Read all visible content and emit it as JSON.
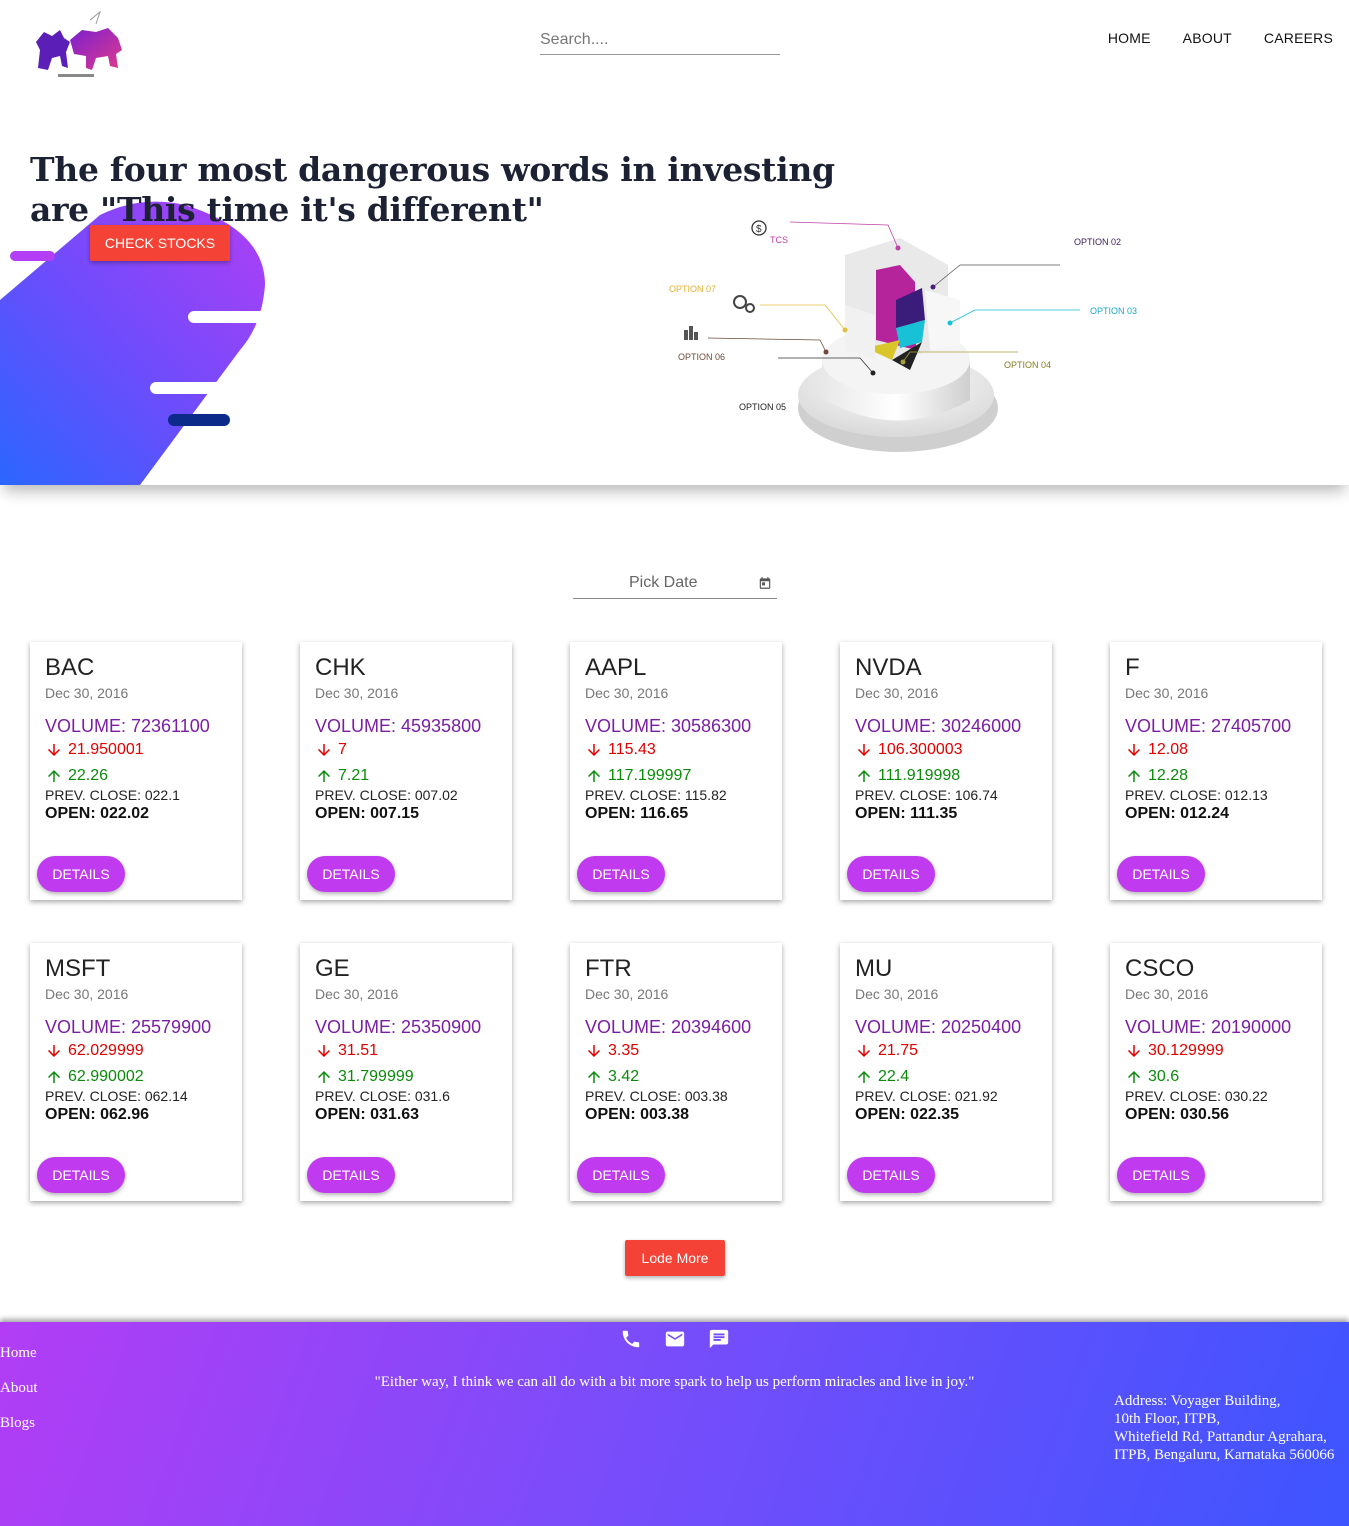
{
  "header": {
    "search_placeholder": "Search....",
    "nav": [
      "HOME",
      "ABOUT",
      "CAREERS"
    ]
  },
  "hero": {
    "quote": "The four most dangerous words in investing are \"This time it's different\"",
    "cta": "CHECK STOCKS",
    "infographic_labels": {
      "tcs": "TCS",
      "option02": "OPTION 02",
      "option03": "OPTION 03",
      "option04": "OPTION 04",
      "option05": "OPTION 05",
      "option06": "OPTION 06",
      "option07": "OPTION 07"
    },
    "accent_colors": [
      "#b33ff5",
      "#2f67ff",
      "#0b2a8a"
    ]
  },
  "date_picker": {
    "label": "Pick Date"
  },
  "stocks": [
    {
      "symbol": "BAC",
      "date": "Dec 30, 2016",
      "volume": "VOLUME: 72361100",
      "low": "21.950001",
      "high": "22.26",
      "prev_close": "PREV. CLOSE: 022.1",
      "open": "OPEN: 022.02",
      "button": "DETAILS"
    },
    {
      "symbol": "CHK",
      "date": "Dec 30, 2016",
      "volume": "VOLUME: 45935800",
      "low": "7",
      "high": "7.21",
      "prev_close": "PREV. CLOSE: 007.02",
      "open": "OPEN: 007.15",
      "button": "DETAILS"
    },
    {
      "symbol": "AAPL",
      "date": "Dec 30, 2016",
      "volume": "VOLUME: 30586300",
      "low": "115.43",
      "high": "117.199997",
      "prev_close": "PREV. CLOSE: 115.82",
      "open": "OPEN: 116.65",
      "button": "DETAILS"
    },
    {
      "symbol": "NVDA",
      "date": "Dec 30, 2016",
      "volume": "VOLUME: 30246000",
      "low": "106.300003",
      "high": "111.919998",
      "prev_close": "PREV. CLOSE: 106.74",
      "open": "OPEN: 111.35",
      "button": "DETAILS"
    },
    {
      "symbol": "F",
      "date": "Dec 30, 2016",
      "volume": "VOLUME: 27405700",
      "low": "12.08",
      "high": "12.28",
      "prev_close": "PREV. CLOSE: 012.13",
      "open": "OPEN: 012.24",
      "button": "DETAILS"
    },
    {
      "symbol": "MSFT",
      "date": "Dec 30, 2016",
      "volume": "VOLUME: 25579900",
      "low": "62.029999",
      "high": "62.990002",
      "prev_close": "PREV. CLOSE: 062.14",
      "open": "OPEN: 062.96",
      "button": "DETAILS"
    },
    {
      "symbol": "GE",
      "date": "Dec 30, 2016",
      "volume": "VOLUME: 25350900",
      "low": "31.51",
      "high": "31.799999",
      "prev_close": "PREV. CLOSE: 031.6",
      "open": "OPEN: 031.63",
      "button": "DETAILS"
    },
    {
      "symbol": "FTR",
      "date": "Dec 30, 2016",
      "volume": "VOLUME: 20394600",
      "low": "3.35",
      "high": "3.42",
      "prev_close": "PREV. CLOSE: 003.38",
      "open": "OPEN: 003.38",
      "button": "DETAILS"
    },
    {
      "symbol": "MU",
      "date": "Dec 30, 2016",
      "volume": "VOLUME: 20250400",
      "low": "21.75",
      "high": "22.4",
      "prev_close": "PREV. CLOSE: 021.92",
      "open": "OPEN: 022.35",
      "button": "DETAILS"
    },
    {
      "symbol": "CSCO",
      "date": "Dec 30, 2016",
      "volume": "VOLUME: 20190000",
      "low": "30.129999",
      "high": "30.6",
      "prev_close": "PREV. CLOSE: 030.22",
      "open": "OPEN: 030.56",
      "button": "DETAILS"
    }
  ],
  "load_more": "Lode More",
  "footer": {
    "links": [
      "Home",
      "About",
      "Blogs"
    ],
    "icons": [
      "phone-icon",
      "email-icon",
      "chat-icon"
    ],
    "quote": "\"Either way, I think we can all do with a bit more spark to help us perform miracles and live in joy.\"",
    "address": [
      "Address: Voyager Building,",
      "10th Floor, ITPB,",
      "Whitefield Rd, Pattandur Agrahara,",
      "ITPB, Bengaluru, Karnataka 560066"
    ]
  }
}
